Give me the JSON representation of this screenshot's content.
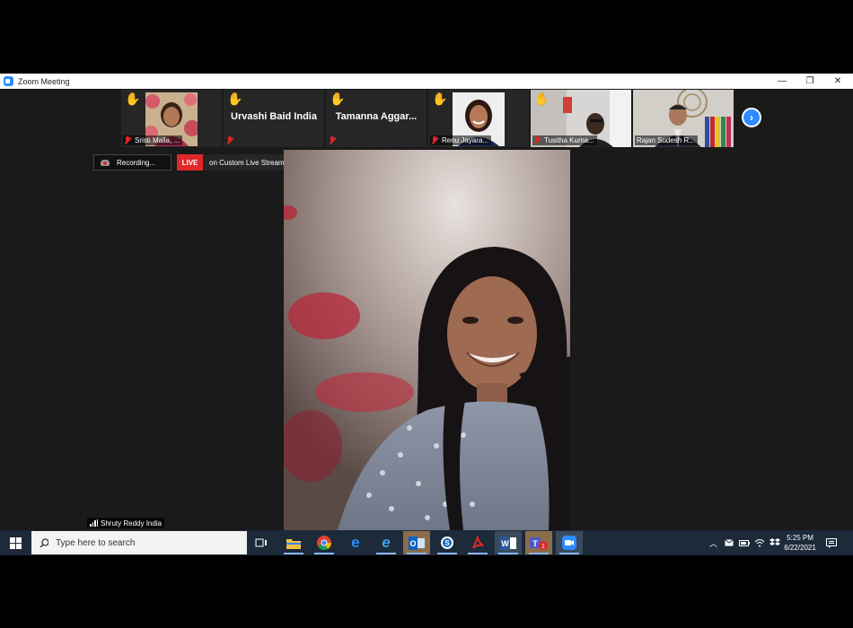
{
  "window": {
    "title": "Zoom Meeting",
    "controls": {
      "minimize": "—",
      "maximize": "❐",
      "close": "✕"
    }
  },
  "participants": [
    {
      "name": "Sristi Malla, ...",
      "hand_raised": true,
      "muted": true,
      "has_video": true
    },
    {
      "name": "Urvashi Baid India",
      "hand_raised": true,
      "muted": true,
      "has_video": false
    },
    {
      "name": "Tamanna  Aggar...",
      "hand_raised": true,
      "muted": true,
      "has_video": false
    },
    {
      "name": "Renu Jayara...",
      "hand_raised": true,
      "muted": true,
      "has_video": true
    },
    {
      "name": "Tusitha Kuma...",
      "hand_raised": true,
      "muted": true,
      "has_video": true
    },
    {
      "name": "Rajan Sudesh R...",
      "hand_raised": false,
      "muted": false,
      "has_video": true
    }
  ],
  "next_icon": "chevron-right",
  "recording": {
    "label": "Recording..."
  },
  "live": {
    "badge": "LIVE",
    "service": "on Custom Live Streaming Service"
  },
  "speaker": {
    "name": "Shruty Reddy India"
  },
  "taskbar": {
    "search_placeholder": "Type here to search",
    "apps": [
      "task-view",
      "file-explorer",
      "chrome",
      "edge",
      "internet-explorer",
      "outlook",
      "skype-for-business",
      "acrobat",
      "word",
      "teams",
      "zoom"
    ],
    "teams_badge": "1",
    "time": "5:25 PM",
    "date": "6/22/2021"
  },
  "colors": {
    "zoom_blue": "#2d8cff",
    "live_red": "#e02828",
    "hand_yellow": "#ffc83d",
    "taskbar": "#1c2a3a"
  }
}
